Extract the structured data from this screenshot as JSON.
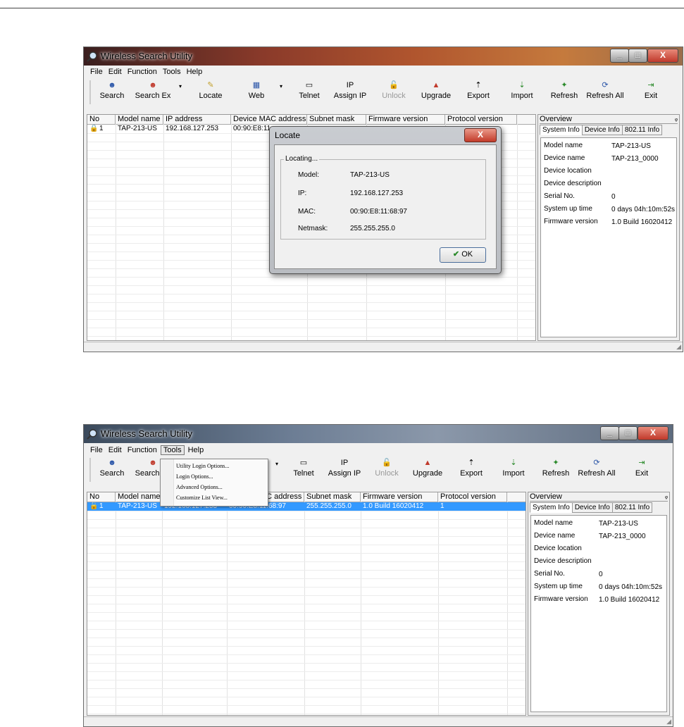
{
  "app": {
    "title": "Wireless Search Utility"
  },
  "window_buttons": {
    "minimize": "_",
    "maximize": "□",
    "close": "X"
  },
  "menu": [
    "File",
    "Edit",
    "Function",
    "Tools",
    "Help"
  ],
  "toolbar": [
    "Search",
    "Search Ex",
    "Locate",
    "Web",
    "Telnet",
    "Assign IP",
    "Unlock",
    "Upgrade",
    "Export",
    "Import",
    "Refresh",
    "Refresh All",
    "Exit"
  ],
  "columns": [
    "No",
    "Model name",
    "IP address",
    "Device MAC address",
    "Subnet mask",
    "Firmware version",
    "Protocol version"
  ],
  "device_row": {
    "no": "1",
    "model": "TAP-213-US",
    "ip": "192.168.127.253",
    "mac": "00:90:E8:11:68:97",
    "mac_partial": "00:90:E8:11",
    "subnet": "255.255.255.0",
    "firmware": "1.0 Build 16020412",
    "protocol": "1"
  },
  "overview": {
    "title": "Overview",
    "pin": "ᵩ",
    "tabs": [
      "System Info",
      "Device Info",
      "802.11 Info"
    ],
    "rows": [
      {
        "label": "Model name",
        "value": "TAP-213-US"
      },
      {
        "label": "Device name",
        "value": "TAP-213_0000"
      },
      {
        "label": "Device location",
        "value": ""
      },
      {
        "label": "Device description",
        "value": ""
      },
      {
        "label": "Serial No.",
        "value": "0"
      },
      {
        "label": "System up time",
        "value": "0 days 04h:10m:52s"
      },
      {
        "label": "Firmware version",
        "value": "1.0 Build 16020412"
      }
    ]
  },
  "locate_dialog": {
    "title": "Locate",
    "close": "X",
    "group": "Locating...",
    "rows": [
      {
        "label": "Model:",
        "value": "TAP-213-US"
      },
      {
        "label": "IP:",
        "value": "192.168.127.253"
      },
      {
        "label": "MAC:",
        "value": "00:90:E8:11:68:97"
      },
      {
        "label": "Netmask:",
        "value": "255.255.255.0"
      }
    ],
    "ok": "OK",
    "ok_check": "✔"
  },
  "tools_menu": [
    "Utility Login Options...",
    "Login Options...",
    "Advanced Options...",
    "Customize List View..."
  ],
  "glyphs": {
    "dropdown_arrow": "▾",
    "grip": "◢"
  }
}
